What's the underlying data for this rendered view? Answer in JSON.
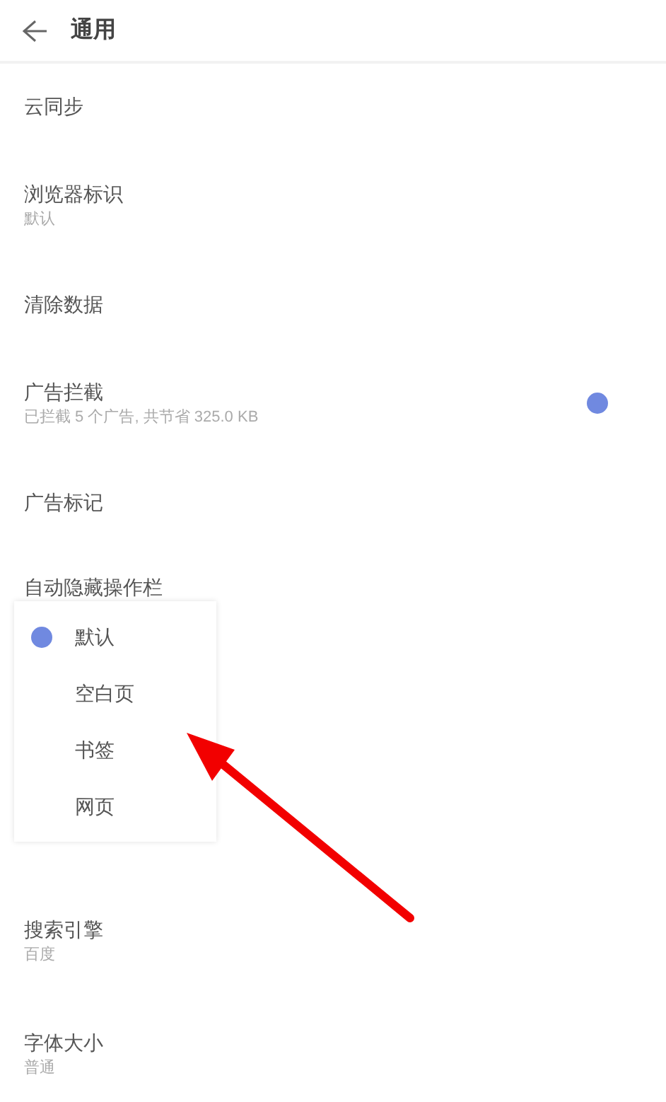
{
  "header": {
    "title": "通用"
  },
  "settings_before": [
    {
      "title": "云同步"
    },
    {
      "title": "浏览器标识",
      "subtitle": "默认"
    },
    {
      "title": "清除数据"
    },
    {
      "title": "广告拦截",
      "subtitle": "已拦截 5 个广告, 共节省 325.0 KB",
      "switch": {
        "on": true
      }
    },
    {
      "title": "广告标记"
    },
    {
      "title": "自动隐藏操作栏"
    }
  ],
  "popup": {
    "options": [
      {
        "label": "默认",
        "selected": true
      },
      {
        "label": "空白页",
        "selected": false
      },
      {
        "label": "书签",
        "selected": false
      },
      {
        "label": "网页",
        "selected": false
      }
    ]
  },
  "settings_after": [
    {
      "title": "搜索引擎",
      "subtitle": "百度"
    },
    {
      "title": "字体大小",
      "subtitle": "普通"
    }
  ]
}
